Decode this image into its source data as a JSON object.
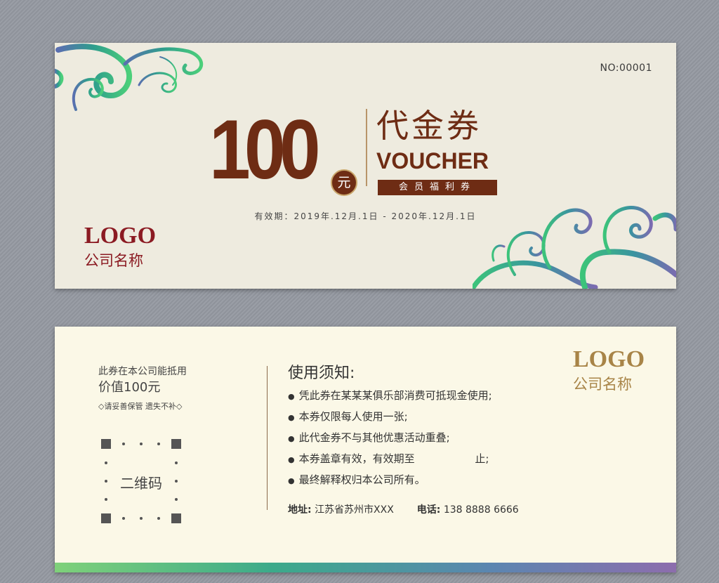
{
  "front": {
    "number": "NO:00001",
    "amount": "100",
    "currency": "元",
    "title_cn": "代金券",
    "title_en": "VOUCHER",
    "member_label": "会员福利券",
    "validity": "有效期：2019年.12月.1日 - 2020年.12月.1日",
    "logo_text": "LOGO",
    "company_name": "公司名称"
  },
  "back": {
    "usage_line": "此券在本公司能抵用",
    "value_line": "价值100元",
    "care_note": "◇请妥善保管 遗失不补◇",
    "qr_label": "二维码",
    "notes_title": "使用须知:",
    "notes": [
      "凭此券在某某某俱乐部消费可抵现金使用;",
      "本券仅限每人使用一张;",
      "此代金券不与其他优惠活动重叠;",
      "本券盖章有效，有效期至                  止;",
      "最终解释权归本公司所有。"
    ],
    "bullet": "●",
    "address_label": "地址:",
    "address": "江苏省苏州市XXX",
    "phone_label": "电话:",
    "phone": "138 8888 6666",
    "logo_text": "LOGO",
    "company_name": "公司名称"
  },
  "colors": {
    "brown": "#6e2c14",
    "logo_red": "#8b1a22",
    "logo_gold": "#a88447",
    "swirl_green": "#3cc47a",
    "swirl_blue": "#4d82a8",
    "swirl_purple": "#7b6bb0"
  }
}
